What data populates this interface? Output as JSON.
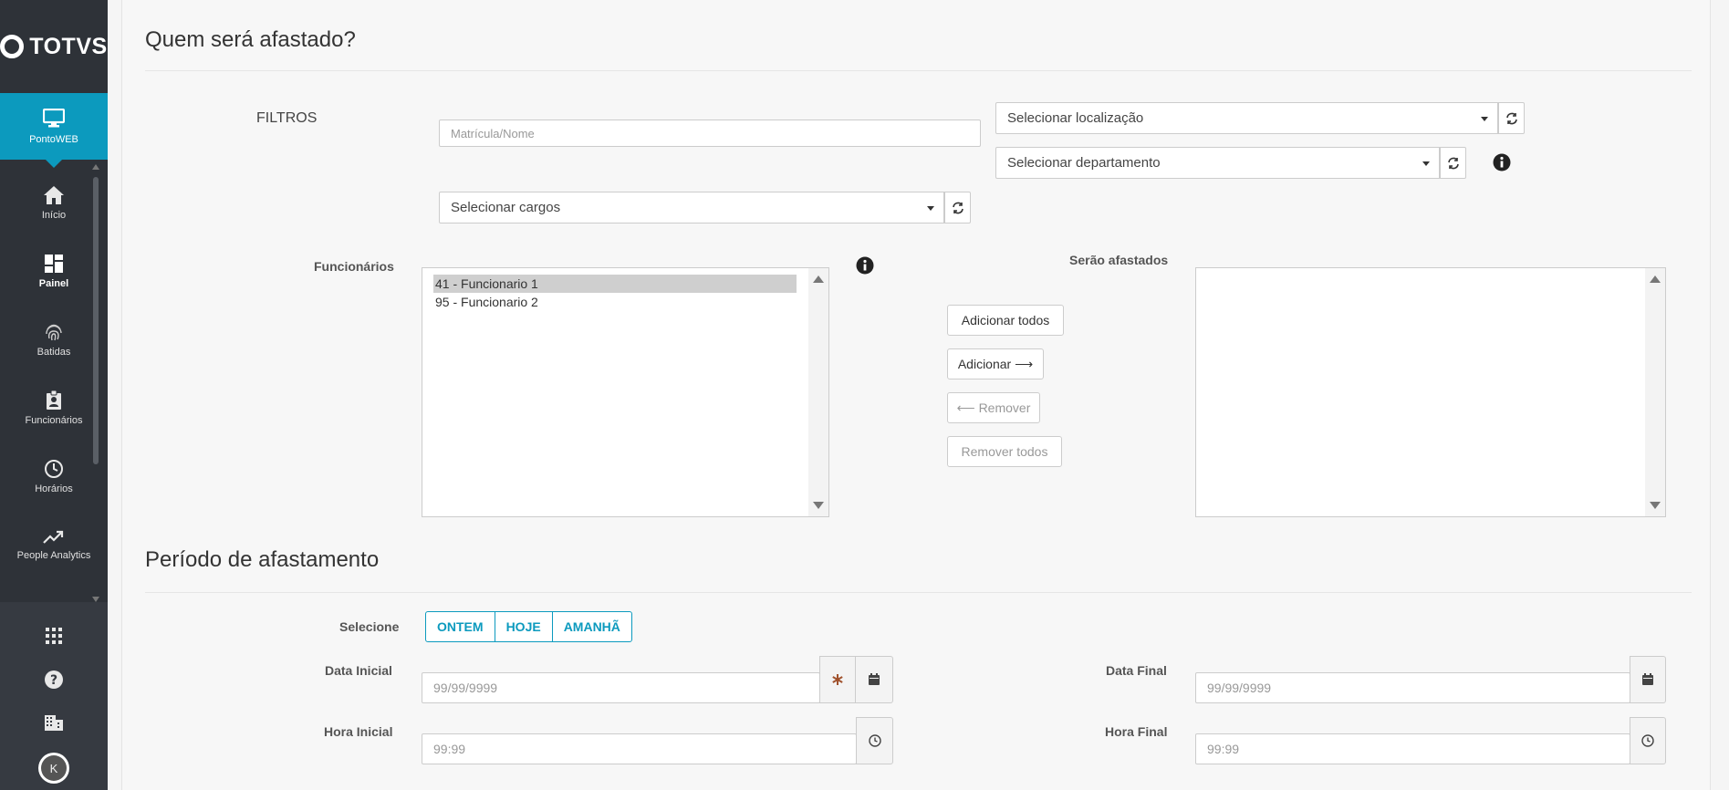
{
  "sidebar": {
    "brand": "TOTVS",
    "active_item": {
      "label": "PontoWEB",
      "icon": "monitor-icon"
    },
    "items": [
      {
        "label": "Início",
        "icon": "home-icon"
      },
      {
        "label": "Painel",
        "icon": "dashboard-icon"
      },
      {
        "label": "Batidas",
        "icon": "fingerprint-icon"
      },
      {
        "label": "Funcionários",
        "icon": "badge-icon"
      },
      {
        "label": "Horários",
        "icon": "clock-icon"
      },
      {
        "label": "People Analytics",
        "icon": "trend-icon"
      }
    ],
    "bottom": {
      "apps_icon": "grid-icon",
      "help_icon": "help-icon",
      "company_icon": "building-icon",
      "avatar_initial": "K"
    }
  },
  "section_who": {
    "title": "Quem será afastado?",
    "filters_label": "FILTROS",
    "search_placeholder": "Matrícula/Nome",
    "location_select": "Selecionar localização",
    "department_select": "Selecionar departamento",
    "roles_select": "Selecionar cargos",
    "employees_label": "Funcionários",
    "employees": [
      {
        "text": "41 - Funcionario 1",
        "selected": true
      },
      {
        "text": "95 - Funcionario 2",
        "selected": false
      }
    ],
    "selected_label": "Serão afastados",
    "buttons": {
      "add_all": "Adicionar todos",
      "add": "Adicionar ⟶",
      "remove": "⟵ Remover",
      "remove_all": "Remover todos"
    }
  },
  "section_period": {
    "title": "Período de afastamento",
    "select_label": "Selecione",
    "quick_options": [
      "ONTEM",
      "HOJE",
      "AMANHÃ"
    ],
    "start_date_label": "Data Inicial",
    "start_date_placeholder": "99/99/9999",
    "end_date_label": "Data Final",
    "end_date_placeholder": "99/99/9999",
    "start_time_label": "Hora Inicial",
    "start_time_placeholder": "99:99",
    "end_time_label": "Hora Final",
    "end_time_placeholder": "99:99"
  },
  "colors": {
    "sidebar_bg": "#2e3238",
    "accent": "#0c9abe",
    "required_mark": "#a0522d"
  }
}
